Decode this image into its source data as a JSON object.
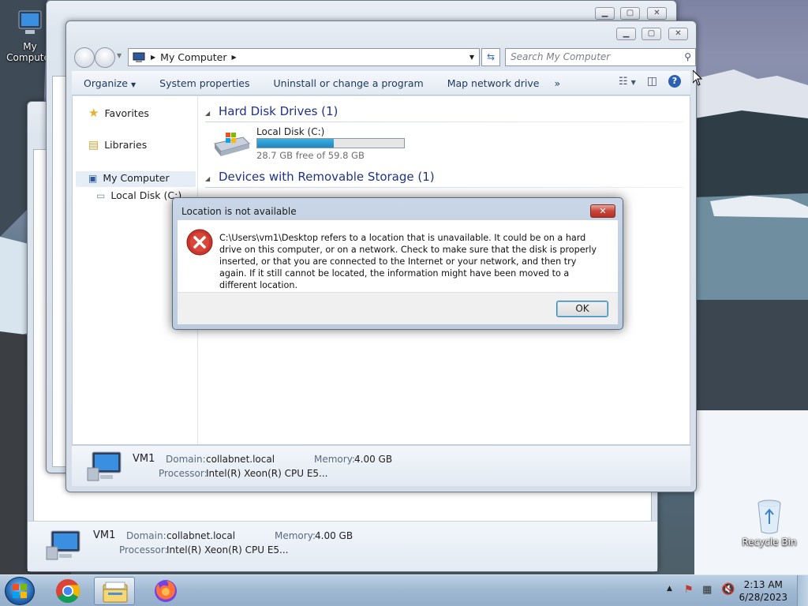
{
  "desktop": {
    "icons": [
      {
        "label": "My Computer",
        "icon": "computer-icon"
      },
      {
        "label": "Recycle Bin",
        "icon": "recycle-bin-icon"
      }
    ]
  },
  "explorer": {
    "address": "My Computer",
    "search_placeholder": "Search My Computer",
    "toolbar": {
      "organize": "Organize",
      "system_properties": "System properties",
      "uninstall": "Uninstall or change a program",
      "map_drive": "Map network drive",
      "more": "»"
    },
    "nav": {
      "favorites": "Favorites",
      "libraries": "Libraries",
      "my_computer": "My Computer",
      "local_disk": "Local Disk (C:)"
    },
    "groups": {
      "hdd": "Hard Disk Drives (1)",
      "removable": "Devices with Removable Storage (1)"
    },
    "drive": {
      "name": "Local Disk (C:)",
      "free_text": "28.7 GB free of 59.8 GB",
      "used_fraction": 0.52
    },
    "details": {
      "name": "VM1",
      "domain_label": "Domain:",
      "domain": "collabnet.local",
      "memory_label": "Memory:",
      "memory": "4.00 GB",
      "processor_label": "Processor:",
      "processor": "Intel(R) Xeon(R) CPU E5..."
    }
  },
  "dialog": {
    "title": "Location is not available",
    "message": "C:\\Users\\vm1\\Desktop refers to a location that is unavailable. It could be on a hard drive on this computer, or on a network. Check to make sure that the disk is properly inserted, or that you are connected to the Internet or your network, and then try again. If it still cannot be located, the information might have been moved to a different location.",
    "ok": "OK",
    "icon": "error-icon"
  },
  "taskbar": {
    "items": [
      "start-orb",
      "chrome-icon",
      "explorer-icon",
      "firefox-icon"
    ],
    "time": "2:13 AM",
    "date": "6/28/2023"
  }
}
